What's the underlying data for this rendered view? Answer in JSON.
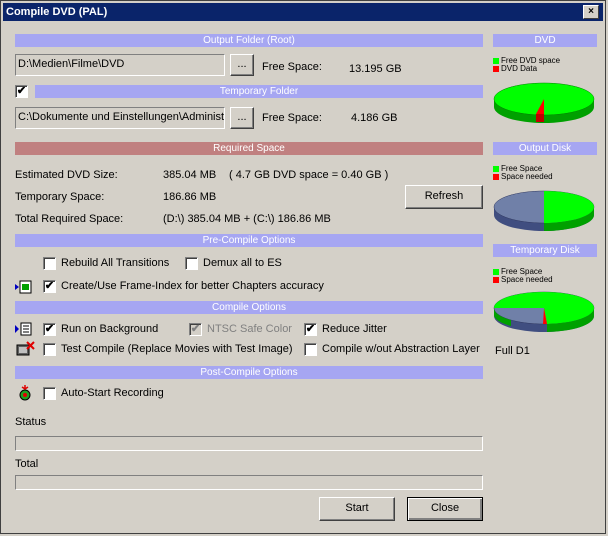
{
  "window": {
    "title": "Compile DVD (PAL)",
    "close_glyph": "×"
  },
  "output": {
    "header": "Output Folder (Root)",
    "path": "D:\\Medien\\Filme\\DVD",
    "browse": "...",
    "free_label": "Free Space:",
    "free_value": "13.195 GB"
  },
  "temp": {
    "checked_glyph": "✔",
    "header": "Temporary Folder",
    "path": "C:\\Dokumente und Einstellungen\\Administrator",
    "browse": "...",
    "free_label": "Free Space:",
    "free_value": "4.186 GB"
  },
  "required": {
    "header": "Required Space",
    "dvd_label": "Estimated DVD Size:",
    "dvd_value": "385.04 MB",
    "dvd_note": "( 4.7 GB DVD space = 0.40 GB )",
    "temp_label": "Temporary Space:",
    "temp_value": "186.86 MB",
    "total_label": "Total Required Space:",
    "total_value": "(D:\\) 385.04 MB + (C:\\) 186.86 MB",
    "refresh": "Refresh"
  },
  "precompile": {
    "header": "Pre-Compile Options",
    "rebuild": "Rebuild All Transitions",
    "demux": "Demux all to ES",
    "frame_index": "Create/Use Frame-Index for better Chapters accuracy",
    "check_glyph": "✔"
  },
  "compile": {
    "header": "Compile Options",
    "background": "Run on Background",
    "ntsc": "NTSC Safe Color",
    "jitter": "Reduce Jitter",
    "test": "Test Compile (Replace Movies with Test Image)",
    "abstraction": "Compile w/out Abstraction Layer",
    "check_glyph": "✔"
  },
  "postcompile": {
    "header": "Post-Compile Options",
    "autostart": "Auto-Start Recording"
  },
  "status": {
    "label": "Status",
    "total_label": "Total"
  },
  "buttons": {
    "start": "Start",
    "close": "Close"
  },
  "side": {
    "dvd": {
      "header": "DVD",
      "legend_a": "Free DVD space",
      "legend_b": "DVD Data",
      "fraction_b": 0.085
    },
    "output_disk": {
      "header": "Output Disk",
      "legend_a": "Free Space",
      "legend_b": "Space needed",
      "fraction_free": 0.5
    },
    "temp_disk": {
      "header": "Temporary Disk",
      "legend_a": "Free Space",
      "legend_b": "Space needed",
      "fraction_free": 0.48
    },
    "format": "Full D1"
  },
  "colors": {
    "free": "#00ff00",
    "used": "#ff0000",
    "disk": "#7080a8",
    "header": "#a6a6f2"
  }
}
